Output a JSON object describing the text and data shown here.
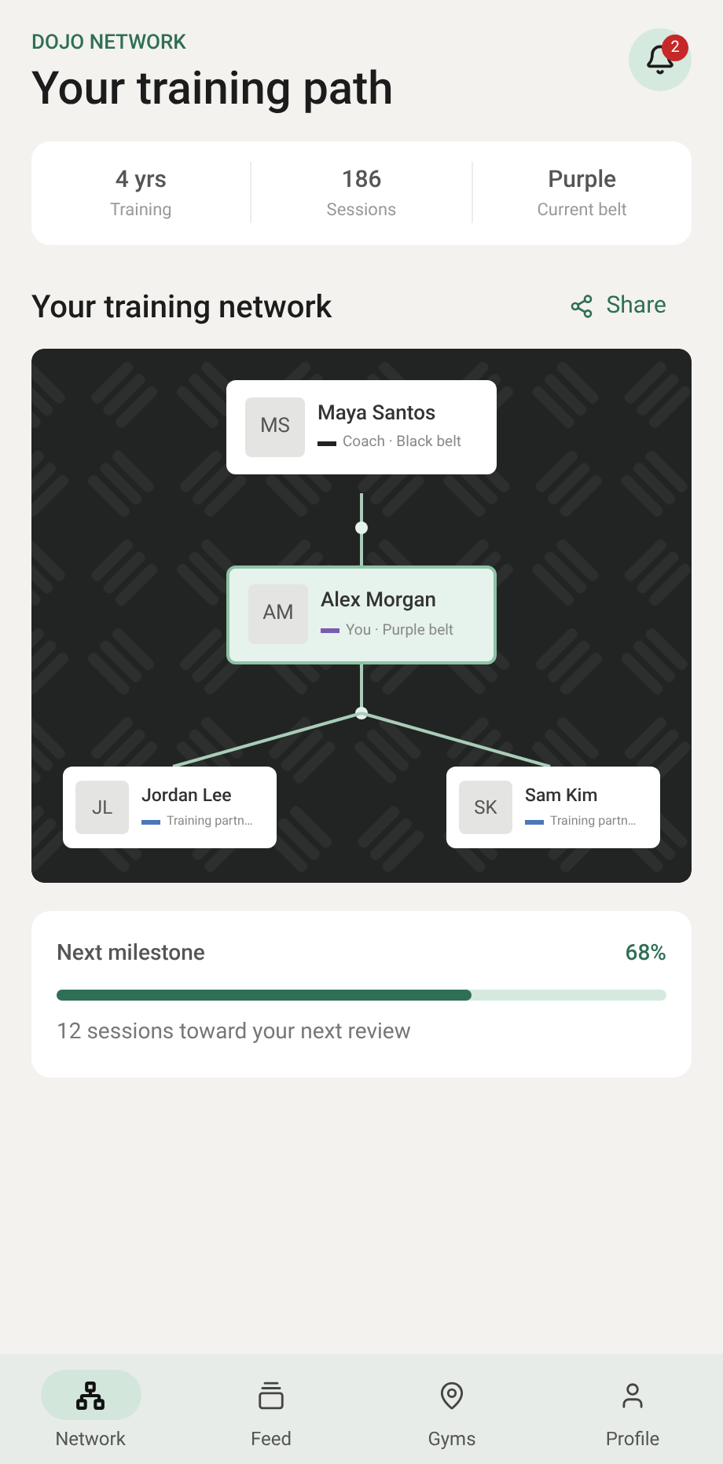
{
  "header": {
    "eyebrow": "DOJO NETWORK",
    "title": "Your training path",
    "notification_count": "2"
  },
  "stats": [
    {
      "value": "4 yrs",
      "label": "Training"
    },
    {
      "value": "186",
      "label": "Sessions"
    },
    {
      "value": "Purple",
      "label": "Current belt"
    }
  ],
  "network": {
    "title": "Your training network",
    "share_label": "Share",
    "nodes": [
      {
        "initials": "MS",
        "name": "Maya Santos",
        "subtitle": "Coach · Black belt",
        "color": "#222222",
        "selected": false
      },
      {
        "initials": "AM",
        "name": "Alex Morgan",
        "subtitle": "You · Purple belt",
        "color": "#7a5bb0",
        "selected": true
      },
      {
        "initials": "JL",
        "name": "Jordan Lee",
        "subtitle": "Training partn…",
        "color": "#4a78b8",
        "selected": false
      },
      {
        "initials": "SK",
        "name": "Sam Kim",
        "subtitle": "Training partn…",
        "color": "#4a78b8",
        "selected": false
      }
    ]
  },
  "milestone": {
    "title": "Next milestone",
    "percent": "68%",
    "level": 0.68,
    "caption": "12 sessions toward your next review"
  },
  "nav": [
    {
      "label": "Network",
      "selected": true
    },
    {
      "label": "Feed",
      "selected": false
    },
    {
      "label": "Gyms",
      "selected": false
    },
    {
      "label": "Profile",
      "selected": false
    }
  ]
}
